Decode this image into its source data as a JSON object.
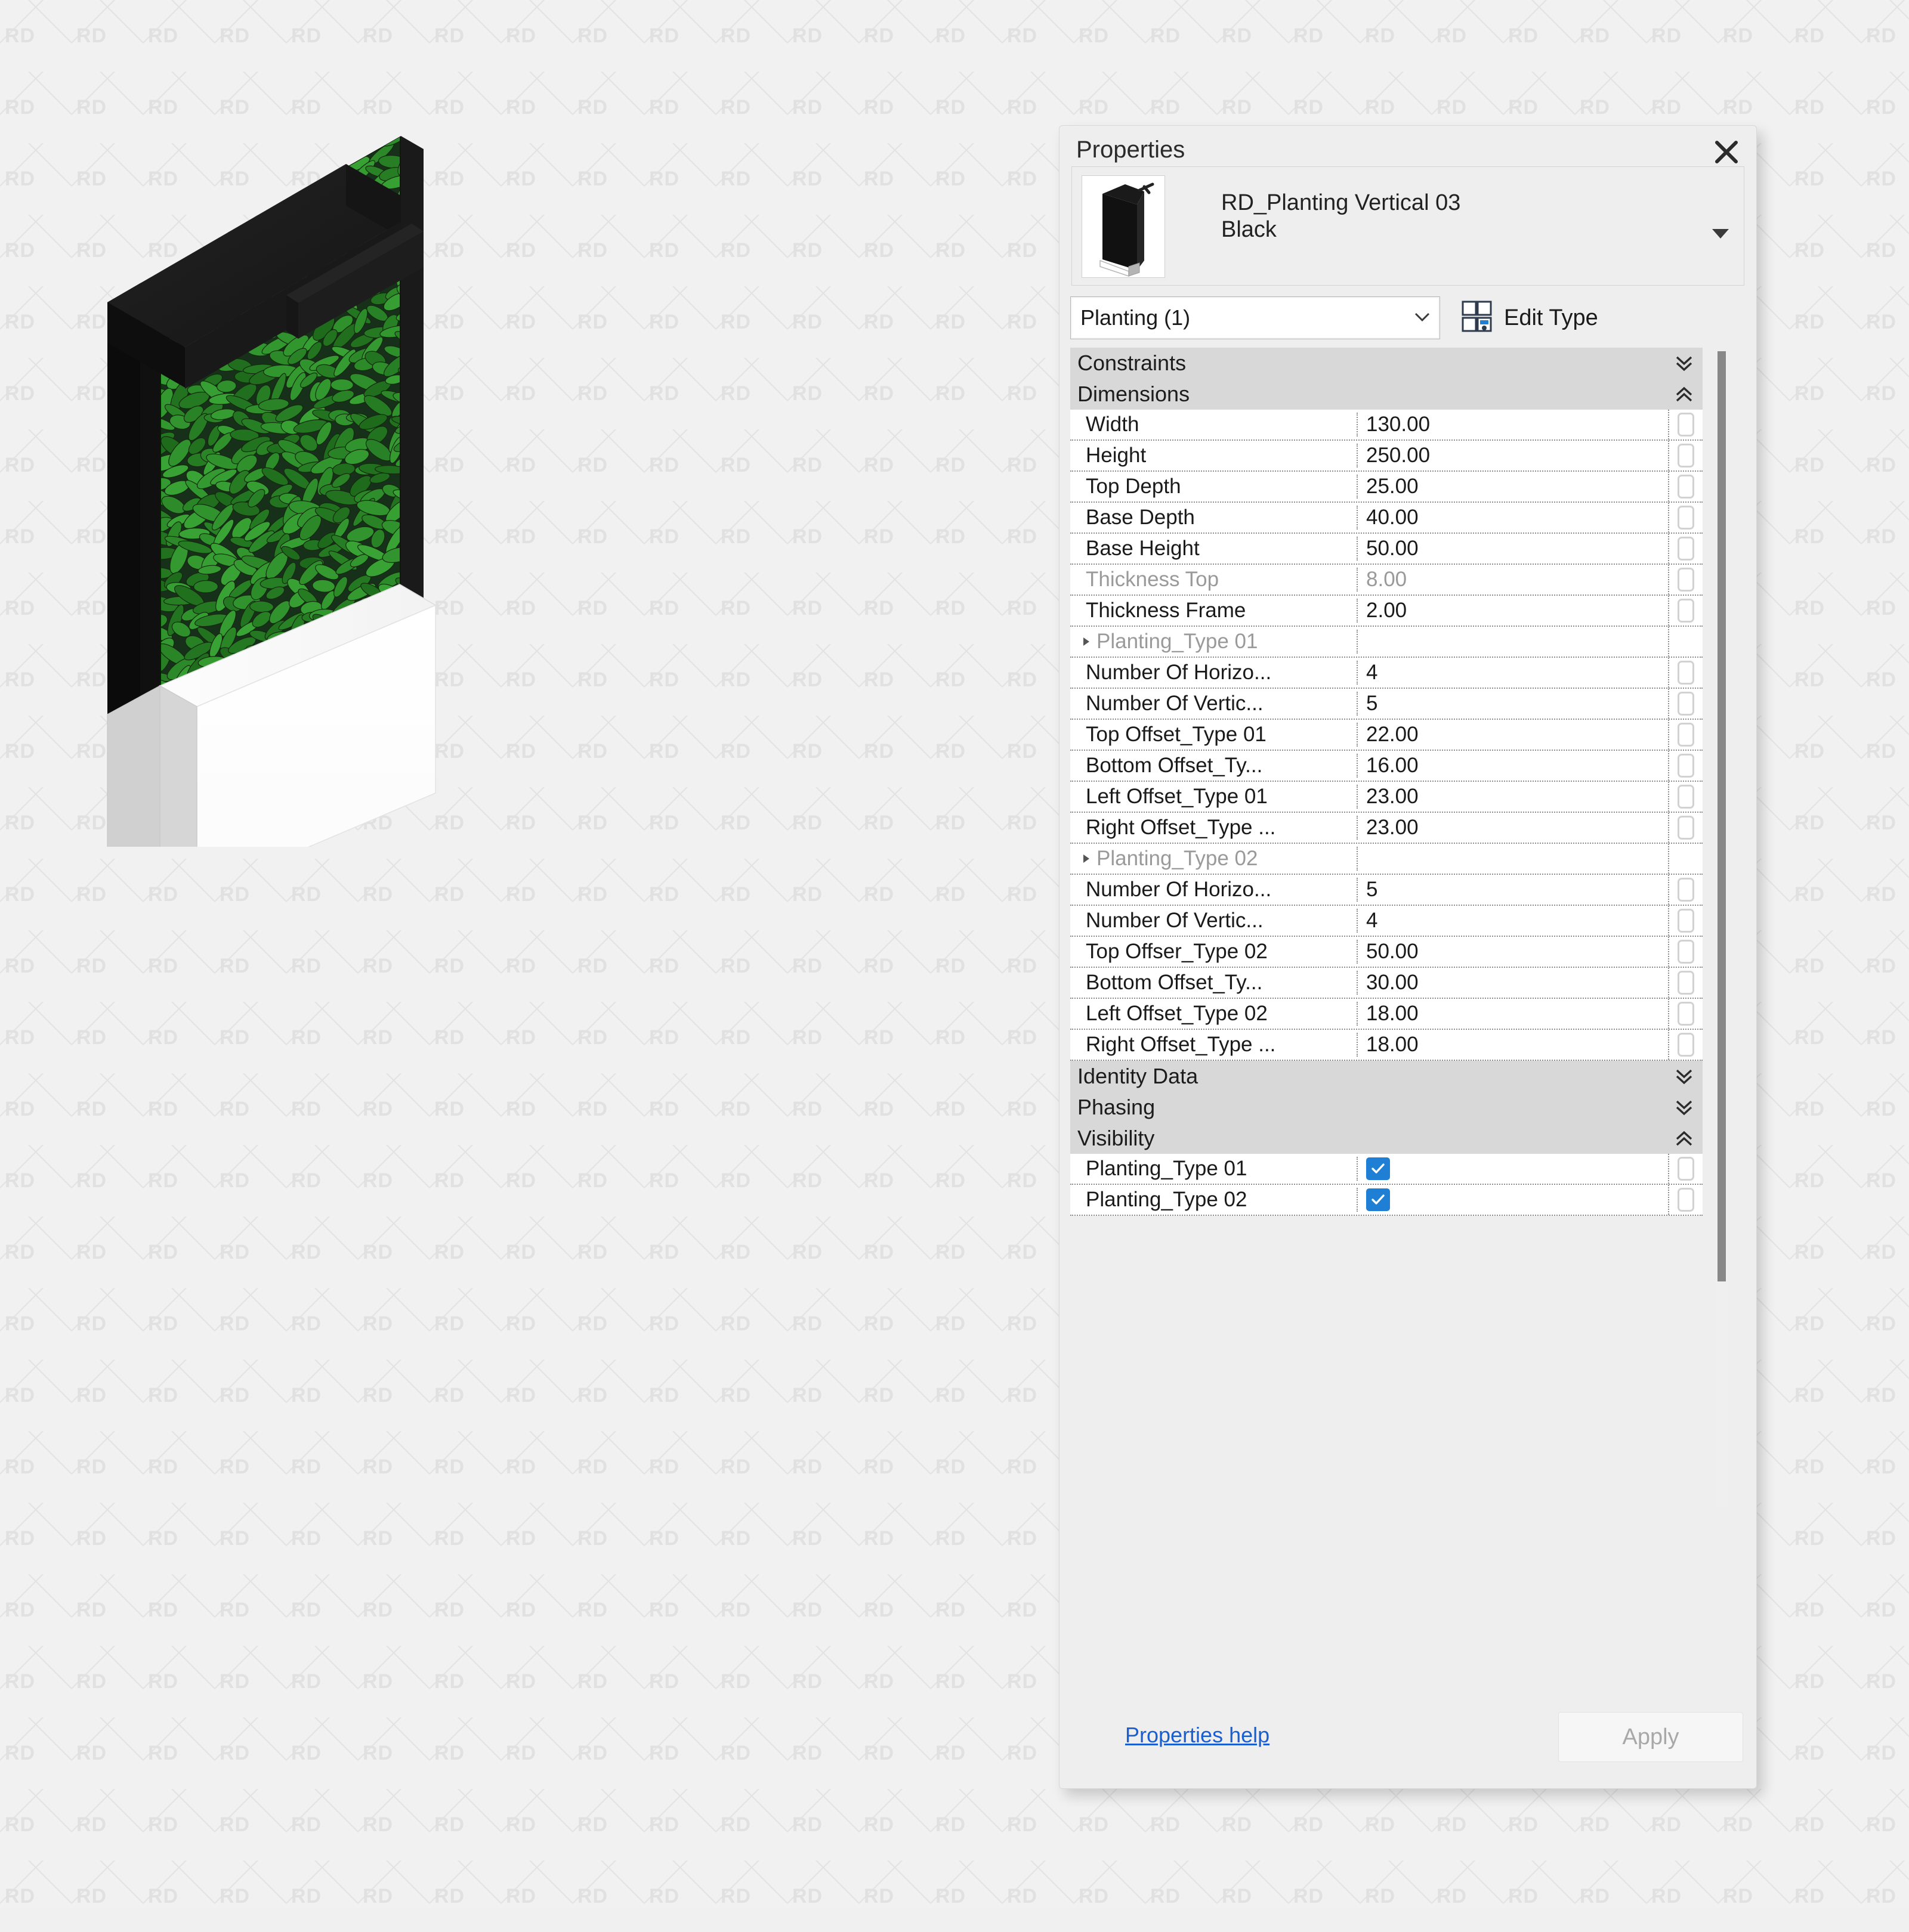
{
  "background": {
    "watermark_text": "RD",
    "bg_color": "#f1f1f1"
  },
  "model": {
    "alt": "Isometric render of black-framed vertical planting wall on white base planter",
    "frame_color": "#1c1c1c",
    "foliage_color": "#3b6b2a",
    "base_color": "#ffffff"
  },
  "panel": {
    "title": "Properties",
    "close_icon": "close-icon",
    "type_name_line1": "RD_Planting Vertical 03",
    "type_name_line2": "Black",
    "type_caret_icon": "chevron-down-icon",
    "category_selector": {
      "value": "Planting (1)",
      "caret_icon": "chevron-down-icon"
    },
    "edit_type": {
      "label": "Edit Type",
      "icon": "edit-type-icon"
    },
    "footer": {
      "help_label": "Properties help",
      "apply_label": "Apply",
      "apply_enabled": false
    },
    "accent_color": "#1f7fd4",
    "link_color": "#1a5fd0"
  },
  "sections": [
    {
      "name": "Constraints",
      "state": "collapsed",
      "chevron": "chevron-double-down-icon",
      "rows": []
    },
    {
      "name": "Dimensions",
      "state": "expanded",
      "chevron": "chevron-double-up-icon",
      "rows": [
        {
          "label": "Width",
          "value": "130.00",
          "kind": "value",
          "dimmed": false
        },
        {
          "label": "Height",
          "value": "250.00",
          "kind": "value",
          "dimmed": false
        },
        {
          "label": "Top Depth",
          "value": "25.00",
          "kind": "value",
          "dimmed": false
        },
        {
          "label": "Base Depth",
          "value": "40.00",
          "kind": "value",
          "dimmed": false
        },
        {
          "label": "Base Height",
          "value": "50.00",
          "kind": "value",
          "dimmed": false
        },
        {
          "label": "Thickness Top",
          "value": "8.00",
          "kind": "value",
          "dimmed": true
        },
        {
          "label": "Thickness Frame",
          "value": "2.00",
          "kind": "value",
          "dimmed": false
        },
        {
          "label": "Planting_Type 01",
          "value": "",
          "kind": "subheader",
          "dimmed": true
        },
        {
          "label": "Number Of Horizo...",
          "value": "4",
          "kind": "value",
          "dimmed": false
        },
        {
          "label": "Number Of Vertic...",
          "value": "5",
          "kind": "value",
          "dimmed": false
        },
        {
          "label": "Top Offset_Type 01",
          "value": "22.00",
          "kind": "value",
          "dimmed": false
        },
        {
          "label": "Bottom Offset_Ty...",
          "value": "16.00",
          "kind": "value",
          "dimmed": false
        },
        {
          "label": "Left Offset_Type 01",
          "value": "23.00",
          "kind": "value",
          "dimmed": false
        },
        {
          "label": "Right Offset_Type ...",
          "value": "23.00",
          "kind": "value",
          "dimmed": false
        },
        {
          "label": "Planting_Type 02",
          "value": "",
          "kind": "subheader",
          "dimmed": true
        },
        {
          "label": "Number Of Horizo...",
          "value": "5",
          "kind": "value",
          "dimmed": false
        },
        {
          "label": "Number Of Vertic...",
          "value": "4",
          "kind": "value",
          "dimmed": false
        },
        {
          "label": "Top Offser_Type 02",
          "value": "50.00",
          "kind": "value",
          "dimmed": false
        },
        {
          "label": "Bottom Offset_Ty...",
          "value": "30.00",
          "kind": "value",
          "dimmed": false
        },
        {
          "label": "Left Offset_Type 02",
          "value": "18.00",
          "kind": "value",
          "dimmed": false
        },
        {
          "label": "Right Offset_Type ...",
          "value": "18.00",
          "kind": "value",
          "dimmed": false
        }
      ]
    },
    {
      "name": "Identity Data",
      "state": "collapsed",
      "chevron": "chevron-double-down-icon",
      "rows": []
    },
    {
      "name": "Phasing",
      "state": "collapsed",
      "chevron": "chevron-double-down-icon",
      "rows": []
    },
    {
      "name": "Visibility",
      "state": "expanded",
      "chevron": "chevron-double-up-icon",
      "rows": [
        {
          "label": "Planting_Type 01",
          "value": "",
          "kind": "checkbox",
          "checked": true,
          "dimmed": false
        },
        {
          "label": "Planting_Type 02",
          "value": "",
          "kind": "checkbox",
          "checked": true,
          "dimmed": false
        }
      ]
    }
  ]
}
